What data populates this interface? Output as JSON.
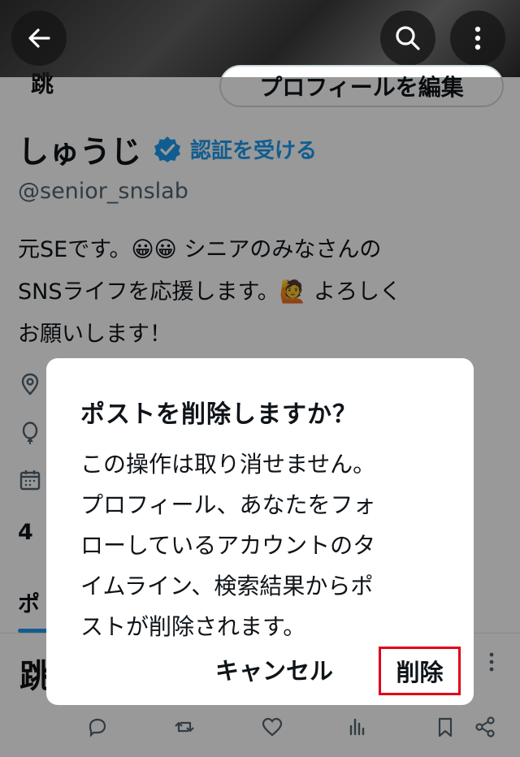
{
  "profile": {
    "avatar_fragment": "跳",
    "edit_profile_label": "プロフィールを編集",
    "display_name": "しゅうじ",
    "get_verified_label": "認証を受ける",
    "handle": "@senior_snslab",
    "bio_line1": "元SEです。😀😀 シニアのみなさんの",
    "bio_line2": "SNSライフを応援します。🙋 よろしく",
    "bio_line3": "お願いします！",
    "follow_fragment": "4",
    "tab_fragment": "ポ",
    "post_avatar_fragment": "跳"
  },
  "icons": {
    "back": "arrow-left-icon",
    "search": "search-icon",
    "more": "more-vertical-icon",
    "verified": "verified-badge-icon",
    "location": "location-pin-icon",
    "birthday": "balloon-icon",
    "joined": "calendar-icon",
    "reply": "reply-icon",
    "repost": "repost-icon",
    "like": "heart-icon",
    "views": "bar-chart-icon",
    "bookmark": "bookmark-icon",
    "share": "share-icon"
  },
  "dialog": {
    "title": "ポストを削除しますか？",
    "message_line1": "この操作は取り消せません。",
    "message_line2": "プロフィール、あなたをフォ",
    "message_line3": "ローしているアカウントのタ",
    "message_line4": "イムライン、検索結果からポ",
    "message_line5": "ストが削除されます。",
    "cancel_label": "キャンセル",
    "delete_label": "削除"
  },
  "colors": {
    "accent": "#1d9bf0",
    "highlight_border": "#e0001b"
  }
}
